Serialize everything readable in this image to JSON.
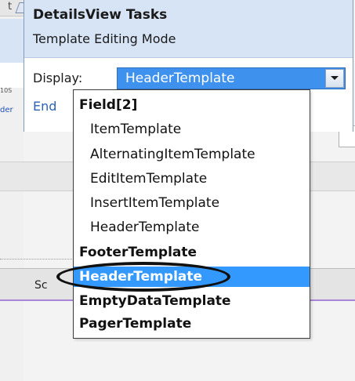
{
  "background": {
    "top_left_fragment": "t",
    "side_fragments": [
      "10S",
      "der"
    ],
    "column_header_text": "Sc"
  },
  "smart_tag": {
    "title": "DetailsView Tasks",
    "subtitle": "Template Editing Mode",
    "display_label": "Display:",
    "display_value": "HeaderTemplate",
    "end_link": "End"
  },
  "dropdown": {
    "items": [
      {
        "label": "Field[2]",
        "kind": "group",
        "selected": false
      },
      {
        "label": "ItemTemplate",
        "kind": "child",
        "selected": false
      },
      {
        "label": "AlternatingItemTemplate",
        "kind": "child",
        "selected": false
      },
      {
        "label": "EditItemTemplate",
        "kind": "child",
        "selected": false
      },
      {
        "label": "InsertItemTemplate",
        "kind": "child",
        "selected": false
      },
      {
        "label": "HeaderTemplate",
        "kind": "child",
        "selected": false
      },
      {
        "label": "FooterTemplate",
        "kind": "group",
        "selected": false
      },
      {
        "label": "HeaderTemplate",
        "kind": "group",
        "selected": true
      },
      {
        "label": "EmptyDataTemplate",
        "kind": "group",
        "selected": false
      },
      {
        "label": "PagerTemplate",
        "kind": "group",
        "selected": false
      }
    ]
  },
  "colors": {
    "selection": "#3399ff",
    "combo_fill": "#3f91ee",
    "panel_header": "#d6e4f6",
    "link": "#2a64b8",
    "annotation_ellipse": "#111111"
  },
  "icons": {
    "combo_button": "chevron-down-icon",
    "smart_tag_glyph": "smart-tag-icon"
  }
}
